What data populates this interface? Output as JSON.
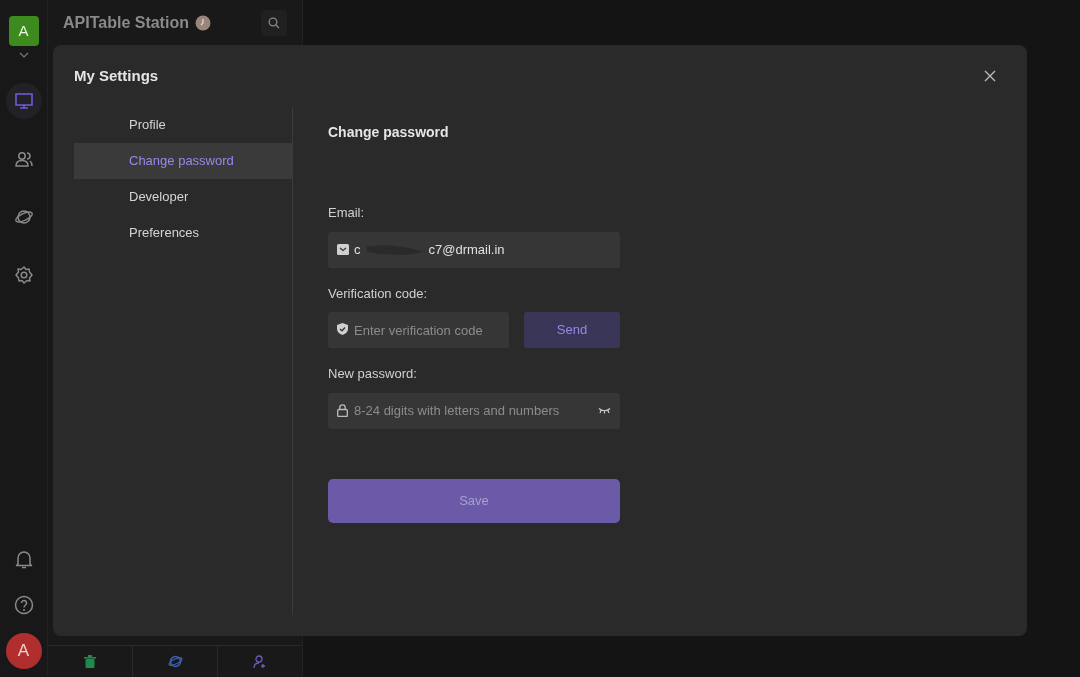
{
  "space": {
    "avatar": "A",
    "title": "APITable Station"
  },
  "rail": [
    {
      "kind": "workbench",
      "selected": true
    },
    {
      "kind": "members",
      "selected": false
    },
    {
      "kind": "explore",
      "selected": false
    },
    {
      "kind": "settings",
      "selected": false
    }
  ],
  "user_avatar": "A",
  "modal": {
    "title": "My Settings",
    "nav": [
      {
        "label": "Profile",
        "selected": false
      },
      {
        "label": "Change password",
        "selected": true
      },
      {
        "label": "Developer",
        "selected": false
      },
      {
        "label": "Preferences",
        "selected": false
      }
    ],
    "section_title": "Change password",
    "fields": [
      {
        "kind": "email",
        "label": "Email:",
        "value_start": "c",
        "value_end": "c7@drmail.in"
      },
      {
        "kind": "code",
        "label": "Verification code:",
        "placeholder": "Enter verification code",
        "button": "Send"
      },
      {
        "kind": "password",
        "label": "New password:",
        "placeholder": "8-24 digits with letters and numbers"
      }
    ],
    "save_button": {
      "label": "Save",
      "disabled": true
    }
  }
}
